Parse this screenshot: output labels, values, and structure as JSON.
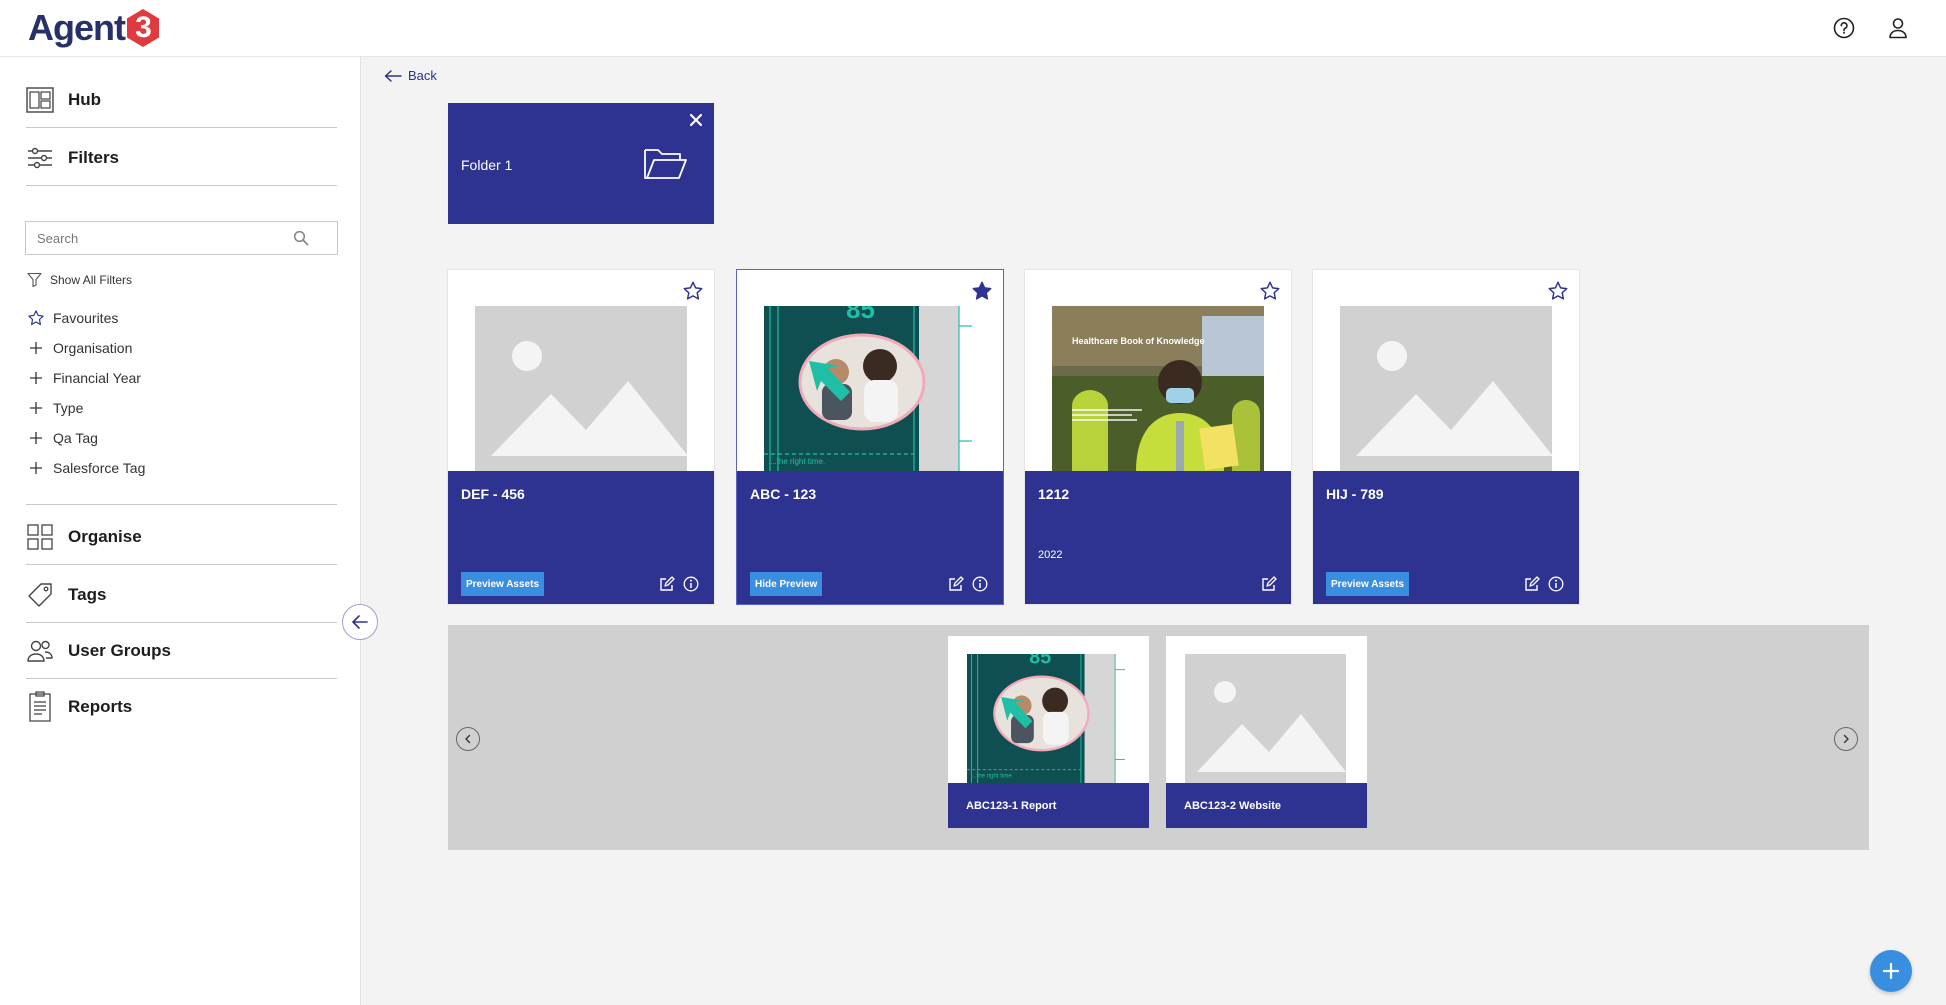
{
  "brand": {
    "logo_text": "Agent",
    "logo_number": "3"
  },
  "header": {
    "help_icon": "help-circle-icon",
    "user_icon": "user-icon"
  },
  "sidebar": {
    "nav": [
      {
        "label": "Hub",
        "icon": "hub-icon"
      },
      {
        "label": "Filters",
        "icon": "sliders-icon"
      }
    ],
    "search": {
      "placeholder": "Search",
      "value": ""
    },
    "show_all_filters": "Show All Filters",
    "filters": [
      {
        "label": "Favourites",
        "icon": "star-icon"
      },
      {
        "label": "Organisation",
        "icon": "plus-icon"
      },
      {
        "label": "Financial Year",
        "icon": "plus-icon"
      },
      {
        "label": "Type",
        "icon": "plus-icon"
      },
      {
        "label": "Qa Tag",
        "icon": "plus-icon"
      },
      {
        "label": "Salesforce Tag",
        "icon": "plus-icon"
      }
    ],
    "sections": [
      {
        "label": "Organise",
        "icon": "grid-icon"
      },
      {
        "label": "Tags",
        "icon": "tag-icon"
      },
      {
        "label": "User Groups",
        "icon": "users-icon"
      },
      {
        "label": "Reports",
        "icon": "report-icon"
      }
    ]
  },
  "main": {
    "back_label": "Back",
    "folder": {
      "name": "Folder 1"
    },
    "cards": [
      {
        "title": "DEF - 456",
        "button": "Preview Assets",
        "favourited": false,
        "thumb": "placeholder",
        "year": ""
      },
      {
        "title": "ABC - 123",
        "button": "Hide Preview",
        "favourited": true,
        "thumb": "people",
        "year": ""
      },
      {
        "title": "1212",
        "button": "",
        "favourited": false,
        "thumb": "healthcare",
        "year": "2022",
        "thumb_text": "Healthcare Book of Knowledge"
      },
      {
        "title": "HIJ - 789",
        "button": "Preview Assets",
        "favourited": false,
        "thumb": "placeholder",
        "year": ""
      }
    ],
    "preview_assets": [
      {
        "title": "ABC123-1 Report",
        "thumb": "people"
      },
      {
        "title": "ABC123-2 Website",
        "thumb": "placeholder"
      }
    ]
  },
  "colors": {
    "primary": "#2e3392",
    "accent": "#3a8ee0",
    "teal": "#1fbfa6"
  }
}
